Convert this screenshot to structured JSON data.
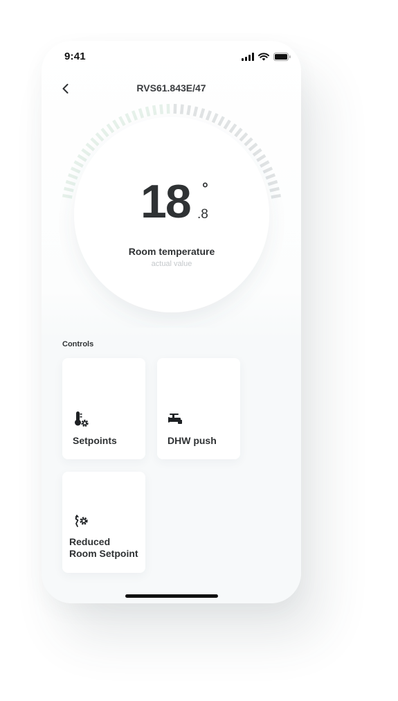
{
  "status_bar": {
    "time": "9:41",
    "icons": [
      "signal-icon",
      "wifi-icon",
      "battery-icon"
    ]
  },
  "nav": {
    "title": "RVS61.843E/47",
    "back_icon": "chevron-left-icon"
  },
  "dial": {
    "temperature_whole": "18",
    "temperature_fraction": ".8",
    "degree_symbol": "°",
    "label": "Room temperature",
    "sublabel": "actual value"
  },
  "controls": {
    "title": "Controls",
    "items": [
      {
        "label": "Setpoints",
        "icon": "thermometer-gear-icon"
      },
      {
        "label": "DHW push",
        "icon": "faucet-icon"
      },
      {
        "label": "Reduced\nRoom Setpoint",
        "icon": "reduced-setpoint-gear-icon"
      }
    ]
  },
  "colors": {
    "tick_light": "#e6f1ea",
    "tick_dark": "#e0e3e4",
    "text_primary": "#2f3234",
    "text_muted": "#c4c8cb"
  }
}
